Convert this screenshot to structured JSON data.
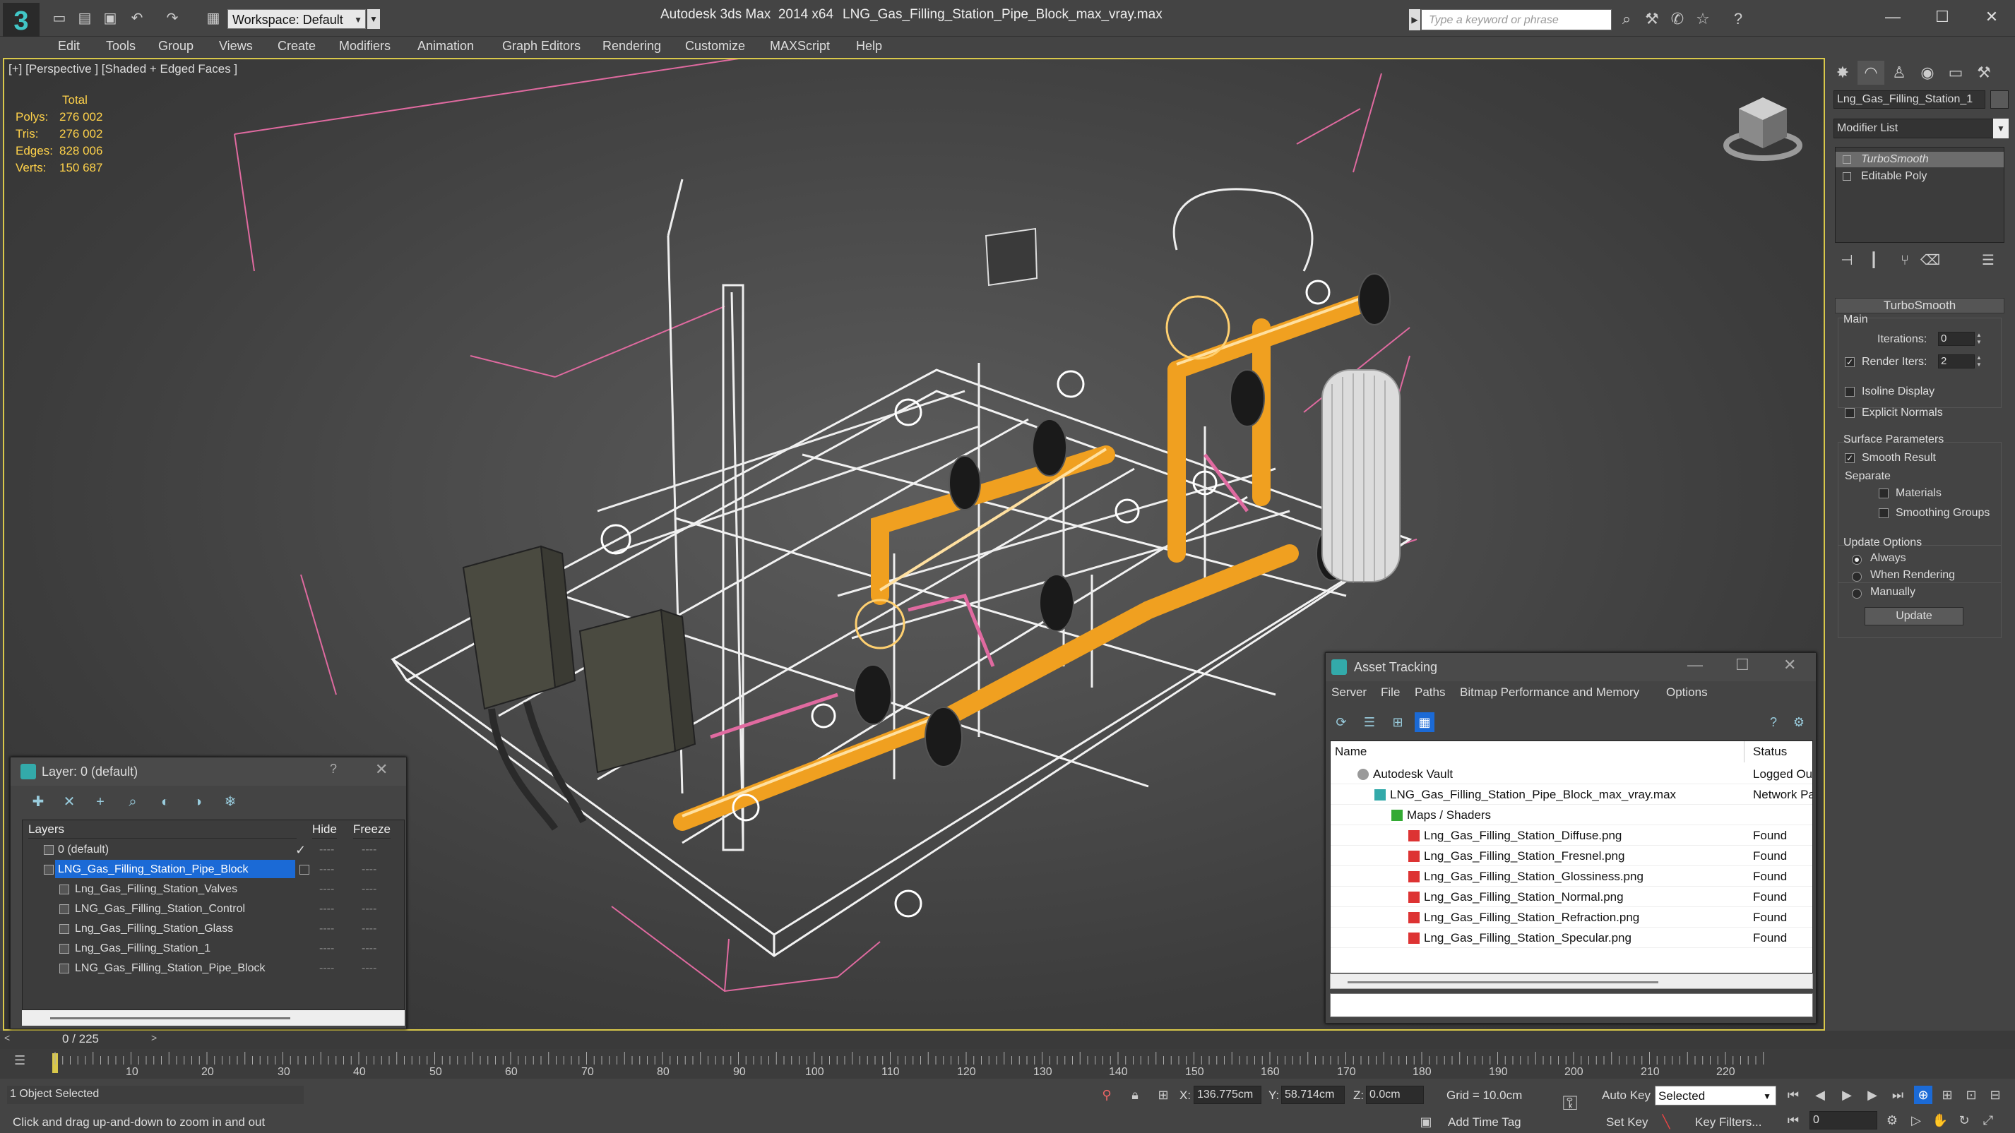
{
  "titlebar": {
    "workspace": "Workspace: Default",
    "app_title": "Autodesk 3ds Max  2014 x64",
    "file_title": "LNG_Gas_Filling_Station_Pipe_Block_max_vray.max",
    "search_placeholder": "Type a keyword or phrase"
  },
  "menu": [
    "Edit",
    "Tools",
    "Group",
    "Views",
    "Create",
    "Modifiers",
    "Animation",
    "Graph Editors",
    "Rendering",
    "Customize",
    "MAXScript",
    "Help"
  ],
  "viewport": {
    "label": "[+] [Perspective ] [Shaded + Edged Faces ]",
    "stats": {
      "header": "Total",
      "rows": [
        {
          "label": "Polys:",
          "value": "276 002"
        },
        {
          "label": "Tris:",
          "value": "276 002"
        },
        {
          "label": "Edges:",
          "value": "828 006"
        },
        {
          "label": "Verts:",
          "value": "150 687"
        }
      ]
    }
  },
  "command_panel": {
    "object_name": "Lng_Gas_Filling_Station_1",
    "modifier_list": "Modifier List",
    "stack": [
      "TurboSmooth",
      "Editable Poly"
    ],
    "turbosmooth": {
      "title": "TurboSmooth",
      "main_label": "Main",
      "iterations_label": "Iterations:",
      "iterations_value": "0",
      "render_iters_label": "Render Iters:",
      "render_iters_value": "2",
      "isoline_label": "Isoline Display",
      "explicit_label": "Explicit Normals",
      "surface_label": "Surface Parameters",
      "smooth_result_label": "Smooth Result",
      "separate_label": "Separate",
      "materials_label": "Materials",
      "smoothing_groups_label": "Smoothing Groups",
      "update_options_label": "Update Options",
      "always_label": "Always",
      "when_rendering_label": "When Rendering",
      "manually_label": "Manually",
      "update_button": "Update"
    }
  },
  "layer_dialog": {
    "title": "Layer: 0 (default)",
    "help": "?",
    "columns": {
      "layers": "Layers",
      "hide": "Hide",
      "freeze": "Freeze"
    },
    "rows": [
      {
        "name": "0 (default)",
        "indent": 0,
        "checked": true
      },
      {
        "name": "LNG_Gas_Filling_Station_Pipe_Block",
        "indent": 0,
        "selected": true
      },
      {
        "name": "Lng_Gas_Filling_Station_Valves",
        "indent": 1
      },
      {
        "name": "LNG_Gas_Filling_Station_Control",
        "indent": 1
      },
      {
        "name": "Lng_Gas_Filling_Station_Glass",
        "indent": 1
      },
      {
        "name": "Lng_Gas_Filling_Station_1",
        "indent": 1
      },
      {
        "name": "LNG_Gas_Filling_Station_Pipe_Block",
        "indent": 1
      }
    ],
    "dash": "----",
    "check": "✓"
  },
  "asset_dialog": {
    "title": "Asset Tracking",
    "menu": [
      "Server",
      "File",
      "Paths",
      "Bitmap Performance and Memory",
      "Options"
    ],
    "columns": {
      "name": "Name",
      "status": "Status"
    },
    "rows": [
      {
        "name": "Autodesk Vault",
        "status": "Logged Out",
        "level": 0
      },
      {
        "name": "LNG_Gas_Filling_Station_Pipe_Block_max_vray.max",
        "status": "Network Path",
        "level": 1
      },
      {
        "name": "Maps / Shaders",
        "status": "",
        "level": 2
      },
      {
        "name": "Lng_Gas_Filling_Station_Diffuse.png",
        "status": "Found",
        "level": 3
      },
      {
        "name": "Lng_Gas_Filling_Station_Fresnel.png",
        "status": "Found",
        "level": 3
      },
      {
        "name": "Lng_Gas_Filling_Station_Glossiness.png",
        "status": "Found",
        "level": 3
      },
      {
        "name": "Lng_Gas_Filling_Station_Normal.png",
        "status": "Found",
        "level": 3
      },
      {
        "name": "Lng_Gas_Filling_Station_Refraction.png",
        "status": "Found",
        "level": 3
      },
      {
        "name": "Lng_Gas_Filling_Station_Specular.png",
        "status": "Found",
        "level": 3
      }
    ]
  },
  "timeline": {
    "frame_label": "0 / 225",
    "ticks": [
      "10",
      "20",
      "30",
      "40",
      "50",
      "60",
      "70",
      "80",
      "90",
      "100",
      "110",
      "120",
      "130",
      "140",
      "150",
      "160",
      "170",
      "180",
      "190",
      "200",
      "210",
      "220"
    ]
  },
  "statusbar": {
    "selection": "1 Object Selected",
    "prompt": "Click and drag up-and-down to zoom in and out",
    "x_label": "X:",
    "x_value": "136.775cm",
    "y_label": "Y:",
    "y_value": "58.714cm",
    "z_label": "Z:",
    "z_value": "0.0cm",
    "grid": "Grid = 10.0cm",
    "add_time_tag": "Add Time Tag",
    "auto_key": "Auto Key",
    "set_key": "Set Key",
    "key_mode": "Selected",
    "key_filters": "Key Filters...",
    "frame_value": "0"
  },
  "colors": {
    "viewport_border": "#d9c84a",
    "stats_text": "#ffd24a",
    "selection_blue": "#1b6ad6",
    "wire_white": "#ffffff",
    "wire_orange": "#f0a020",
    "wire_pink": "#e06aa0"
  }
}
